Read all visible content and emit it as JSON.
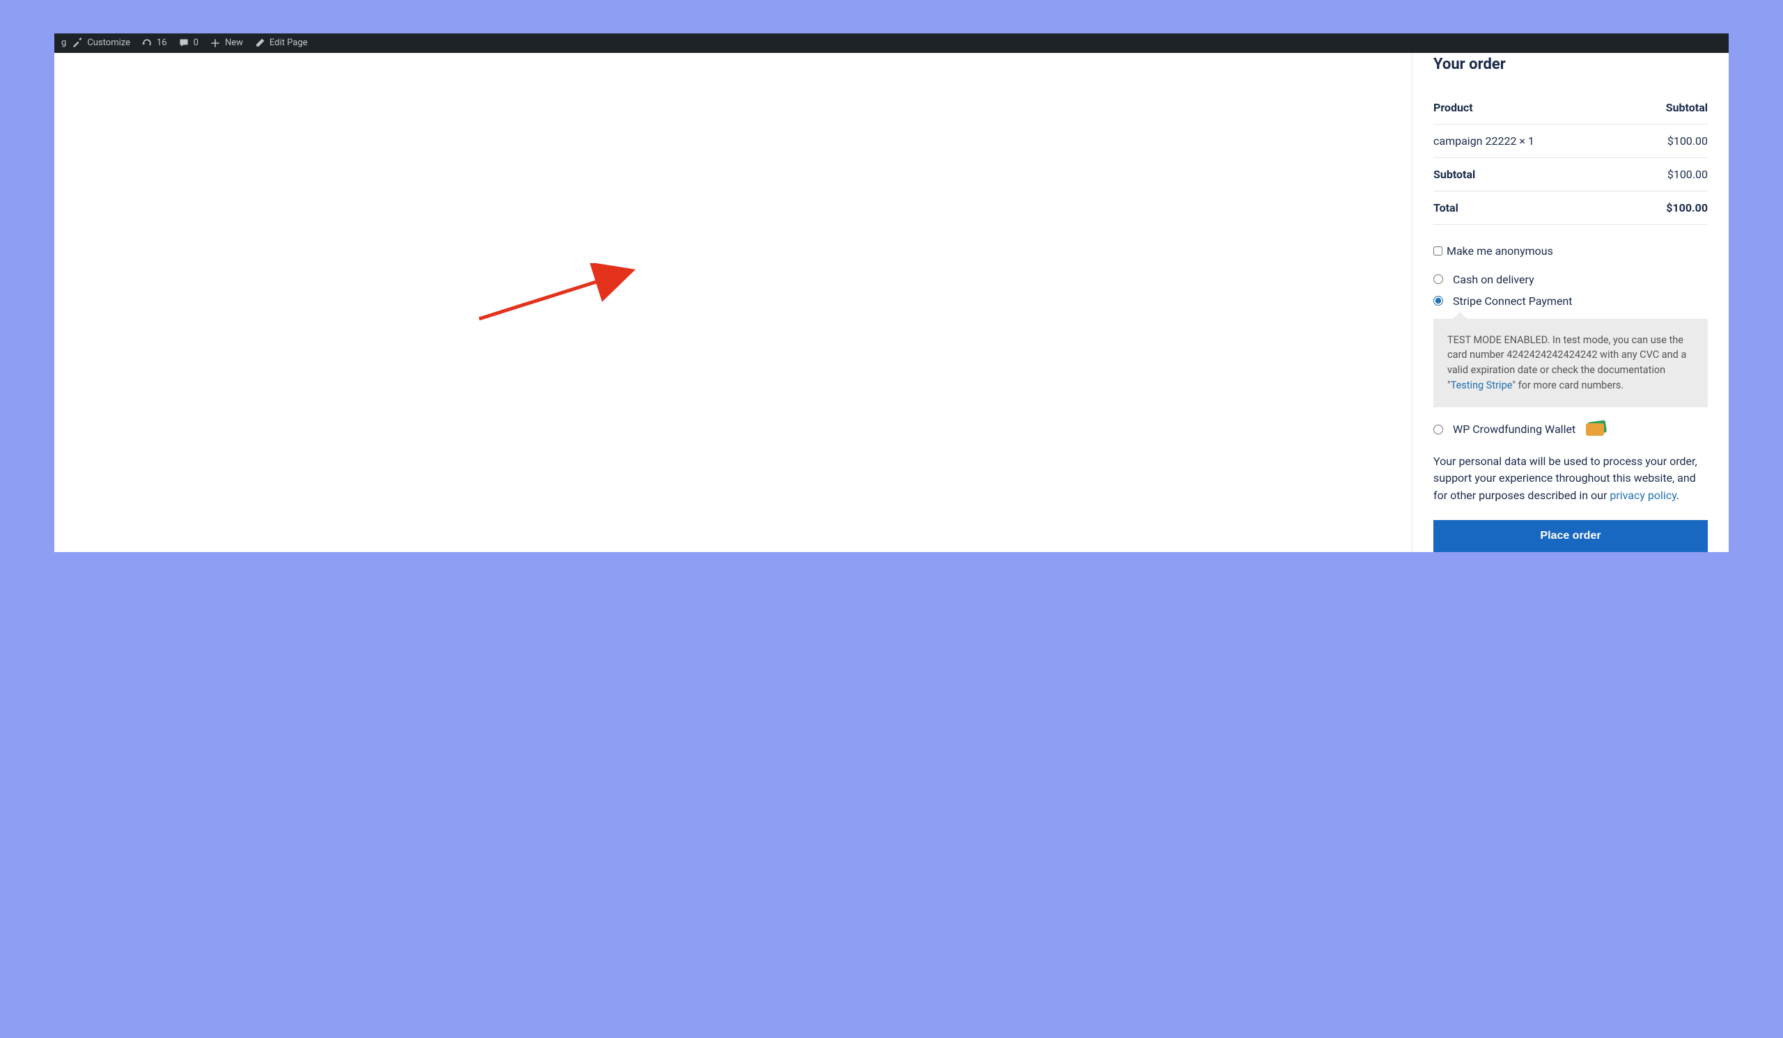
{
  "adminbar": {
    "partial_label": "g",
    "customize": "Customize",
    "refresh_count": "16",
    "comment_count": "0",
    "new_label": "New",
    "edit_page": "Edit Page"
  },
  "order": {
    "title": "Your order",
    "header_product": "Product",
    "header_subtotal": "Subtotal",
    "line_item_name": "campaign 22222  × 1",
    "line_item_price": "$100.00",
    "subtotal_label": "Subtotal",
    "subtotal_value": "$100.00",
    "total_label": "Total",
    "total_value": "$100.00"
  },
  "anonymous_label": "Make me anonymous",
  "payments": {
    "cod": "Cash on delivery",
    "stripe": "Stripe Connect Payment",
    "stripe_info_before": "TEST MODE ENABLED. In test mode, you can use the card number 4242424242424242 with any CVC and a valid expiration date or check the documentation \"",
    "stripe_link": "Testing Stripe",
    "stripe_info_after": "\" for more card numbers.",
    "wallet": "WP Crowdfunding Wallet"
  },
  "privacy": {
    "text_before": "Your personal data will be used to process your order, support your experience throughout this website, and for other purposes described in our ",
    "link": "privacy policy",
    "text_after": "."
  },
  "place_order": "Place order"
}
